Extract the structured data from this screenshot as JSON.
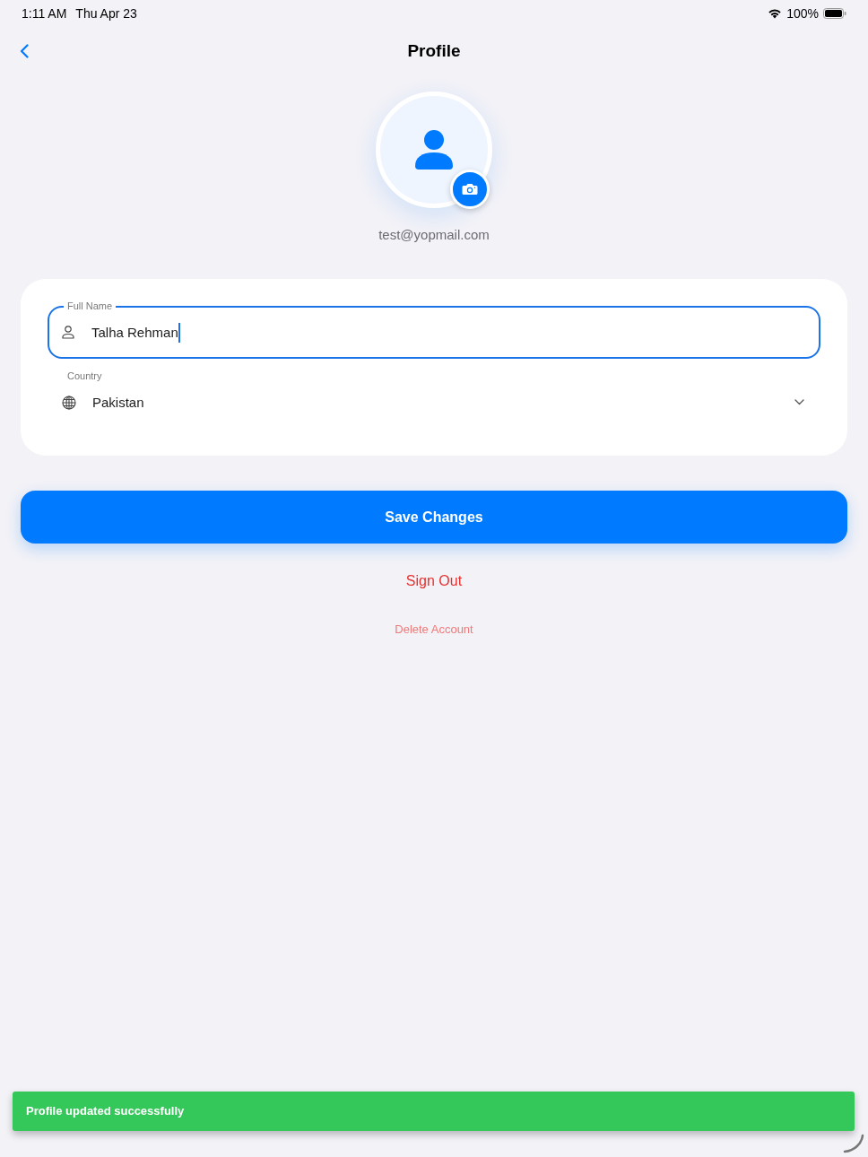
{
  "status_bar": {
    "time": "1:11 AM",
    "date": "Thu Apr 23",
    "battery": "100%"
  },
  "nav": {
    "title": "Profile"
  },
  "profile": {
    "email": "test@yopmail.com"
  },
  "form": {
    "fields": [
      {
        "kind": "text",
        "label": "Full Name",
        "value": "Talha Rehman",
        "focused": true
      },
      {
        "kind": "select",
        "label": "Country",
        "value": "Pakistan",
        "focused": false
      }
    ]
  },
  "actions": [
    {
      "kind": "primary",
      "label": "Save Changes"
    },
    {
      "kind": "danger",
      "label": "Sign Out"
    },
    {
      "kind": "danger_subtle",
      "label": "Delete Account"
    }
  ],
  "toast": {
    "message": "Profile updated successfully"
  }
}
